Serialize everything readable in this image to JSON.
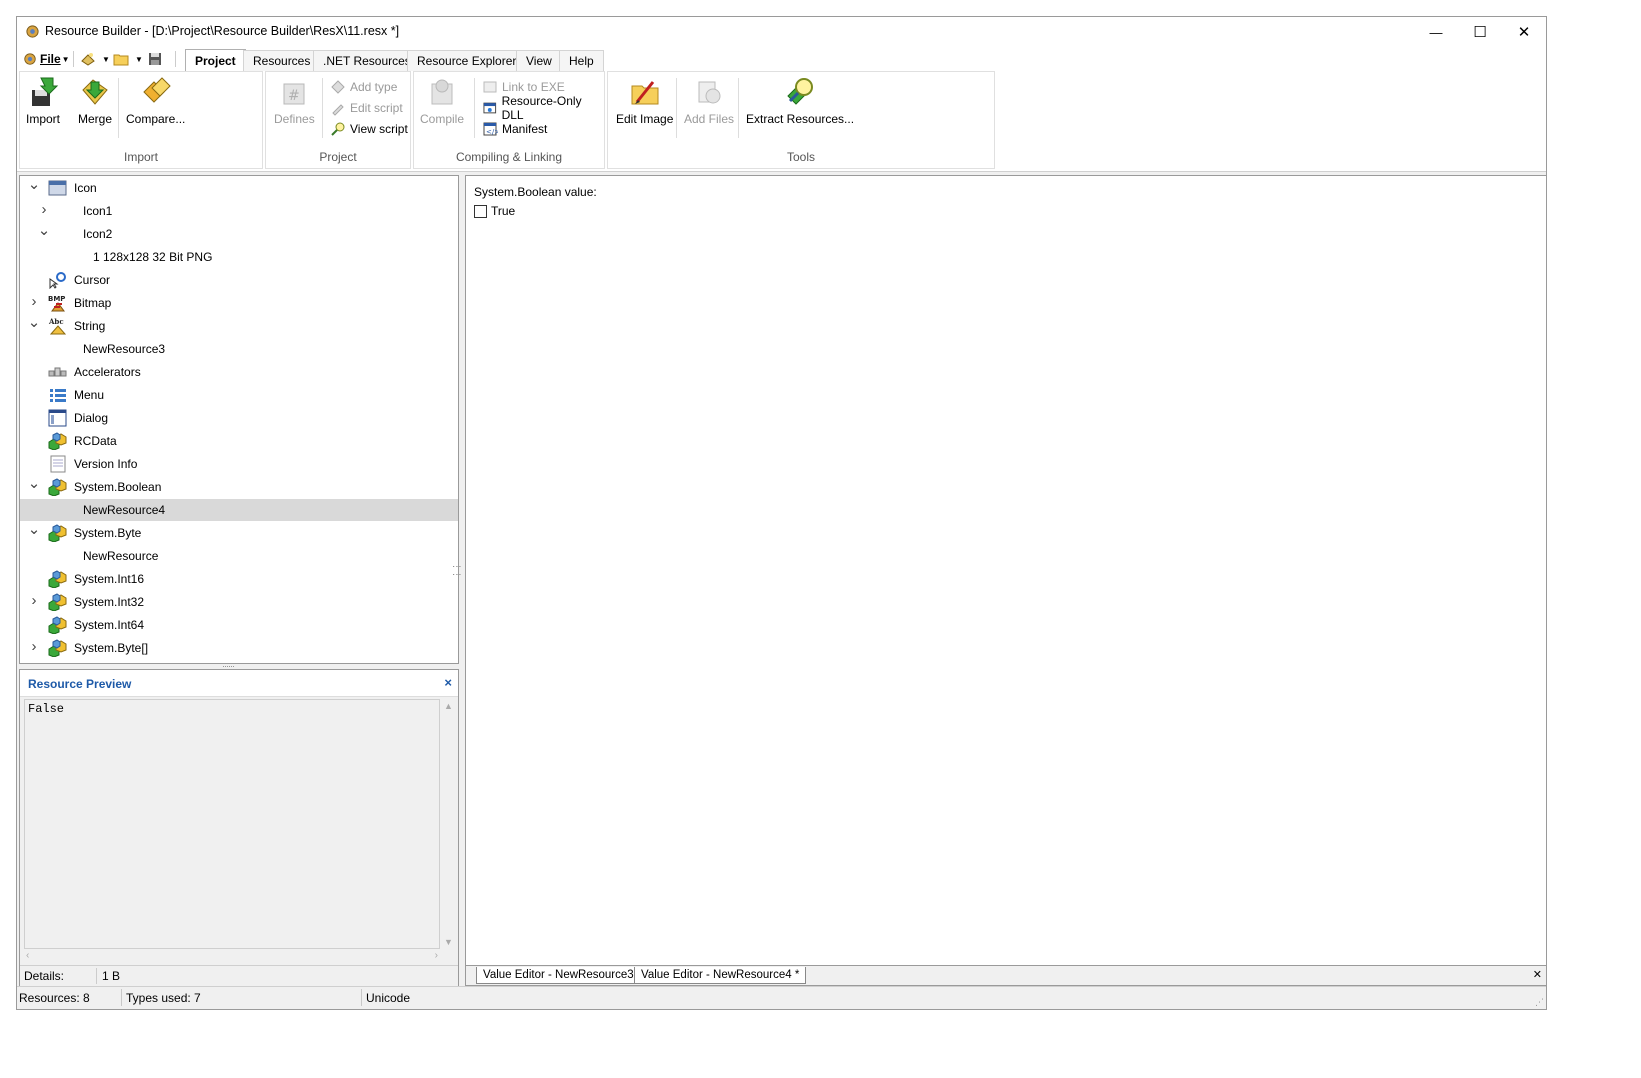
{
  "window": {
    "title": "Resource Builder - [D:\\Project\\Resource Builder\\ResX\\11.resx *]",
    "minimize_glyph": "—",
    "maximize_glyph": "☐",
    "close_glyph": "✕"
  },
  "menubar": {
    "file_label": "File",
    "tabs": [
      "Project",
      "Resources",
      ".NET Resources",
      "Resource Explorer",
      "View",
      "Help"
    ],
    "active_tab": "Project"
  },
  "ribbon": {
    "import_group": {
      "label": "Import",
      "buttons": [
        "Import",
        "Merge",
        "Compare..."
      ]
    },
    "project_group": {
      "label": "Project",
      "defines": "Defines",
      "add_type": "Add type",
      "edit_script": "Edit script",
      "view_script": "View script"
    },
    "compiling_group": {
      "label": "Compiling & Linking",
      "compile": "Compile",
      "link_to_exe": "Link to EXE",
      "resource_only_dll": "Resource-Only DLL",
      "manifest": "Manifest"
    },
    "tools_group": {
      "label": "Tools",
      "edit_image": "Edit Image",
      "add_files": "Add Files",
      "extract_resources": "Extract Resources..."
    }
  },
  "tree": {
    "nodes": [
      {
        "label": "Icon",
        "level": 0,
        "twisty": "expanded",
        "icon": "icon-folder-icon"
      },
      {
        "label": "Icon1",
        "level": 1,
        "twisty": "collapsed",
        "icon": ""
      },
      {
        "label": "Icon2",
        "level": 1,
        "twisty": "expanded",
        "icon": ""
      },
      {
        "label": "1 128x128 32 Bit PNG",
        "level": 2,
        "twisty": "none",
        "icon": ""
      },
      {
        "label": "Cursor",
        "level": 0,
        "twisty": "none",
        "icon": "cursor-icon"
      },
      {
        "label": "Bitmap",
        "level": 0,
        "twisty": "collapsed",
        "icon": "bmp-icon"
      },
      {
        "label": "String",
        "level": 0,
        "twisty": "expanded",
        "icon": "string-icon"
      },
      {
        "label": "NewResource3",
        "level": 1,
        "twisty": "none",
        "icon": ""
      },
      {
        "label": "Accelerators",
        "level": 0,
        "twisty": "none",
        "icon": "accelerators-icon"
      },
      {
        "label": "Menu",
        "level": 0,
        "twisty": "none",
        "icon": "menu-icon"
      },
      {
        "label": "Dialog",
        "level": 0,
        "twisty": "none",
        "icon": "dialog-icon"
      },
      {
        "label": "RCData",
        "level": 0,
        "twisty": "none",
        "icon": "cubes-icon"
      },
      {
        "label": "Version Info",
        "level": 0,
        "twisty": "none",
        "icon": "version-info-icon"
      },
      {
        "label": "System.Boolean",
        "level": 0,
        "twisty": "expanded",
        "icon": "cubes-icon"
      },
      {
        "label": "NewResource4",
        "level": 1,
        "twisty": "none",
        "icon": "",
        "selected": true
      },
      {
        "label": "System.Byte",
        "level": 0,
        "twisty": "expanded",
        "icon": "cubes-icon"
      },
      {
        "label": "NewResource",
        "level": 1,
        "twisty": "none",
        "icon": ""
      },
      {
        "label": "System.Int16",
        "level": 0,
        "twisty": "none",
        "icon": "cubes-icon"
      },
      {
        "label": "System.Int32",
        "level": 0,
        "twisty": "collapsed",
        "icon": "cubes-icon"
      },
      {
        "label": "System.Int64",
        "level": 0,
        "twisty": "none",
        "icon": "cubes-icon"
      },
      {
        "label": "System.Byte[]",
        "level": 0,
        "twisty": "collapsed",
        "icon": "cubes-icon"
      }
    ]
  },
  "preview": {
    "title": "Resource Preview",
    "close_glyph": "×",
    "content": "False",
    "details_label": "Details:",
    "details_value": "1 B"
  },
  "editor": {
    "value_label": "System.Boolean value:",
    "checkbox_label": "True",
    "checkbox_checked": false
  },
  "doc_tabs": [
    "Value Editor - NewResource3 *",
    "Value Editor - NewResource4 *"
  ],
  "doc_close_glyph": "✕",
  "statusbar": {
    "resources": "Resources: 8",
    "types_used": "Types used: 7",
    "encoding": "Unicode"
  }
}
